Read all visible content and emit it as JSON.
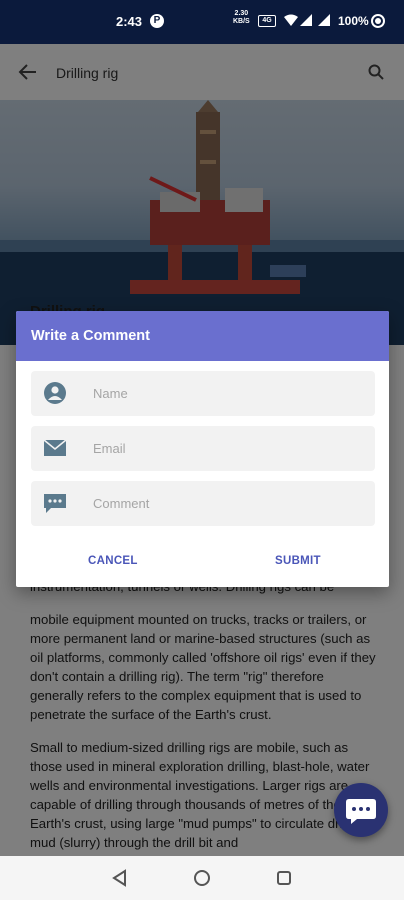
{
  "status_bar": {
    "time": "2:43",
    "net_speed_value": "2.30",
    "net_speed_unit": "KB/S",
    "sim_label": "4G",
    "battery": "100%"
  },
  "app_bar": {
    "title": "Drilling rig",
    "back_icon": "arrow-left-icon",
    "search_icon": "search-icon"
  },
  "article": {
    "heading": "Drilling rig",
    "partial_line": "instrumentation, tunnels or wells. Drilling rigs can be",
    "paragraphs": [
      "mobile equipment mounted on trucks, tracks or trailers, or more permanent land or marine-based structures (such as oil platforms, commonly called 'offshore oil rigs' even if they don't contain a drilling rig). The term \"rig\" therefore generally refers to the complex equipment that is used to penetrate the surface of the Earth's crust.",
      "Small to medium-sized drilling rigs are mobile, such as those used in mineral exploration drilling, blast-hole, water wells and environmental investigations. Larger rigs are capable of drilling through thousands of metres of the Earth's crust, using large \"mud pumps\" to circulate drilling mud (slurry) through the drill bit and"
    ]
  },
  "dialog": {
    "title": "Write a Comment",
    "fields": [
      {
        "icon": "person-icon",
        "placeholder": "Name",
        "value": ""
      },
      {
        "icon": "mail-icon",
        "placeholder": "Email",
        "value": ""
      },
      {
        "icon": "comment-icon",
        "placeholder": "Comment",
        "value": ""
      }
    ],
    "cancel_label": "CANCEL",
    "submit_label": "SUBMIT"
  },
  "fab": {
    "icon": "chat-bubble-icon"
  },
  "nav_bar": {
    "icons": [
      "back-triangle-icon",
      "home-circle-icon",
      "recents-square-icon"
    ]
  },
  "colors": {
    "status_bar": "#0b1a3c",
    "dialog_header": "#6a6fcf",
    "button_text": "#4a56b8",
    "fab": "#2a3272"
  }
}
